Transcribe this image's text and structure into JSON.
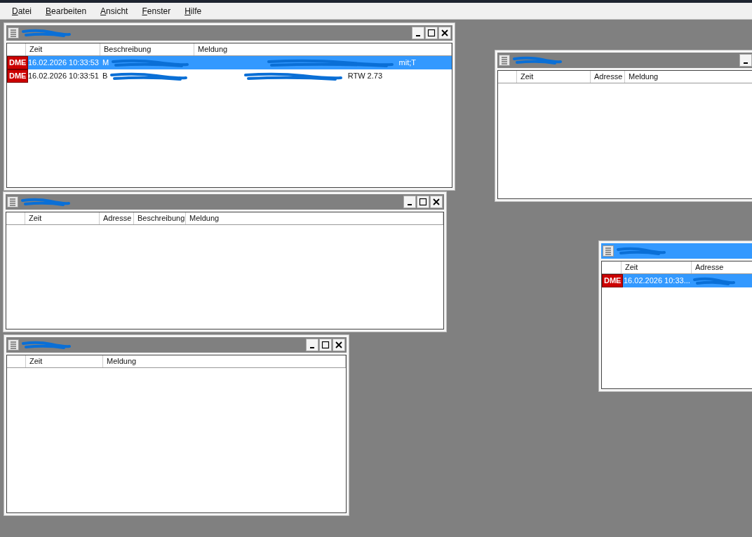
{
  "menu": [
    {
      "label": "Datei"
    },
    {
      "label": "Bearbeiten"
    },
    {
      "label": "Ansicht"
    },
    {
      "label": "Fenster"
    },
    {
      "label": "Hilfe"
    }
  ],
  "windows": [
    {
      "active": false,
      "columns": [
        "Zeit",
        "Beschreibung",
        "Meldung"
      ],
      "rows": [
        {
          "selected": true,
          "badge": "DME",
          "cells": [
            "16.02.2026 10:33:53",
            "M",
            "mit;T"
          ]
        },
        {
          "selected": false,
          "badge": "DME",
          "cells": [
            "16.02.2026 10:33:51",
            "B",
            "RTW 2.73"
          ]
        }
      ]
    },
    {
      "active": false,
      "columns": [
        "Zeit",
        "Adresse",
        "Beschreibung",
        "Meldung"
      ]
    },
    {
      "active": false,
      "columns": [
        "Zeit",
        "Meldung"
      ]
    },
    {
      "active": false,
      "columns": [
        "Zeit",
        "Adresse",
        "Meldung"
      ]
    },
    {
      "active": true,
      "columns": [
        "Zeit",
        "Adresse"
      ],
      "rows": [
        {
          "selected": true,
          "badge": "DME",
          "cells": [
            "16.02.2026 10:33..."
          ]
        }
      ]
    }
  ]
}
